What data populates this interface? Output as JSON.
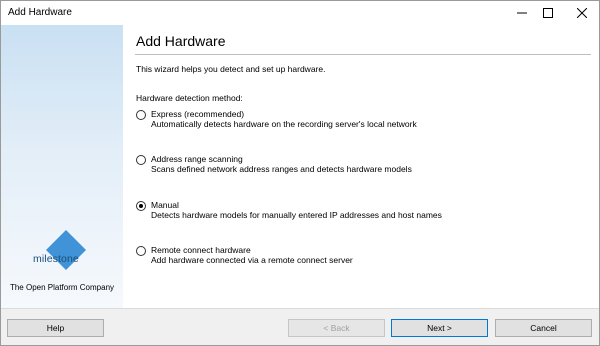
{
  "window": {
    "title": "Add Hardware"
  },
  "sidebar": {
    "logo_text": "milestone",
    "tagline": "The Open Platform Company",
    "brand_color": "#3f93d6"
  },
  "content": {
    "heading": "Add Hardware",
    "intro": "This wizard helps you detect and set up hardware.",
    "method_label": "Hardware detection method:",
    "options": [
      {
        "title": "Express (recommended)",
        "description": "Automatically detects hardware on the recording server's local network",
        "selected": false
      },
      {
        "title": "Address range scanning",
        "description": "Scans defined network address ranges and detects hardware models",
        "selected": false
      },
      {
        "title": "Manual",
        "description": "Detects hardware models for manually entered IP addresses and host names",
        "selected": true
      },
      {
        "title": "Remote connect hardware",
        "description": "Add hardware connected via a remote connect server",
        "selected": false
      }
    ]
  },
  "footer": {
    "help_label": "Help",
    "back_label": "< Back",
    "next_label": "Next >",
    "cancel_label": "Cancel"
  }
}
